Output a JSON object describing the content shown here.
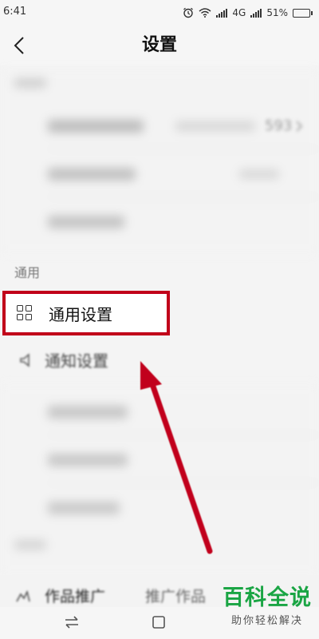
{
  "status_bar": {
    "time": "6:41",
    "network": "4G",
    "battery": "51%",
    "battery_level": 0.51
  },
  "header": {
    "title": "设置"
  },
  "account_section": {
    "partial_value": "593"
  },
  "general_section": {
    "header": "通用",
    "items": [
      {
        "label": "通用设置",
        "icon": "grid-icon"
      },
      {
        "label": "通知设置",
        "icon": "notification-icon"
      }
    ]
  },
  "bottom_row": {
    "label": "作品推广",
    "value": "推广作品"
  },
  "watermark": {
    "title": "百科全说",
    "subtitle": "助你轻松解决"
  },
  "colors": {
    "highlight": "#c1001a",
    "watermark_green": "#1aa544"
  },
  "icons": {
    "back": "back-arrow-icon",
    "alarm": "alarm-icon",
    "wifi": "wifi-icon",
    "signal": "signal-icon",
    "battery": "battery-icon",
    "chevron": "chevron-right-icon",
    "nav_switch": "switch-arrows-icon",
    "nav_home": "square-icon"
  }
}
